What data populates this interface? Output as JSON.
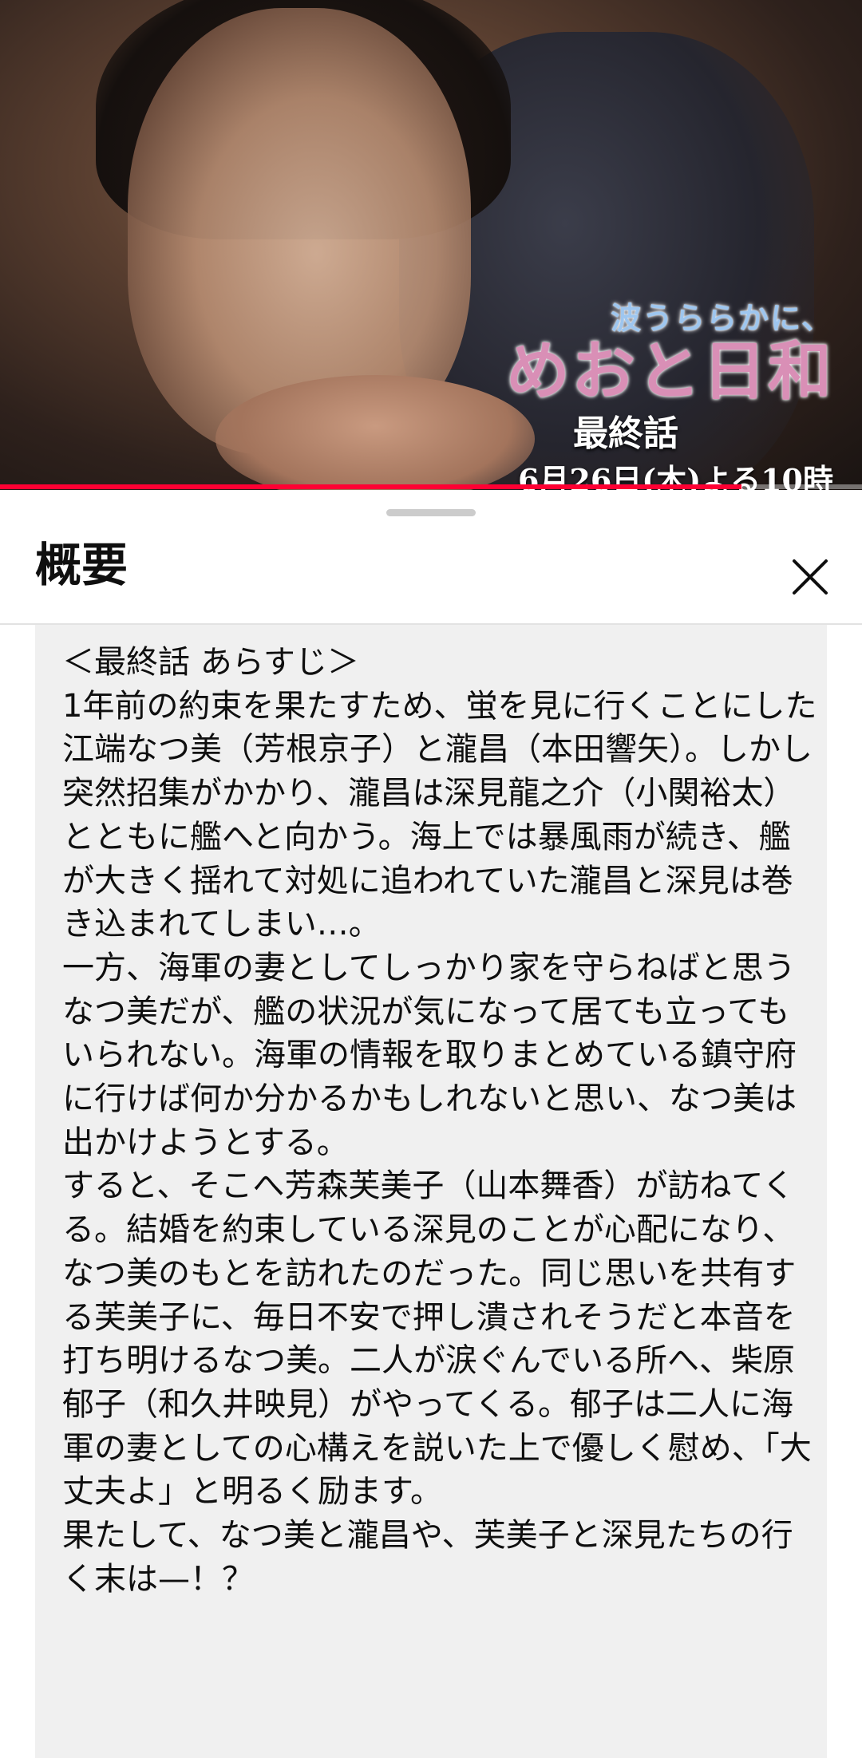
{
  "video": {
    "overlay_subtitle": "波うららかに、",
    "overlay_title": "めおと日和",
    "overlay_episode": "最終話",
    "overlay_airtime": "6月26日(木)よる10時",
    "progress_fraction": 0.86,
    "progress_color": "#ff0033"
  },
  "sheet": {
    "title": "概要",
    "close_icon": "close-icon",
    "description": "＜最終話 あらすじ＞\n1年前の約束を果たすため、蛍を見に行くことにした江端なつ美（芳根京子）と瀧昌（本田響矢）。しかし突然招集がかかり、瀧昌は深見龍之介（小関裕太）とともに艦へと向かう。海上では暴風雨が続き、艦が大きく揺れて対処に追われていた瀧昌と深見は巻き込まれてしまい…。\n一方、海軍の妻としてしっかり家を守らねばと思うなつ美だが、艦の状況が気になって居ても立ってもいられない。海軍の情報を取りまとめている鎮守府に行けば何か分かるかもしれないと思い、なつ美は出かけようとする。\nすると、そこへ芳森芙美子（山本舞香）が訪ねてくる。結婚を約束している深見のことが心配になり、なつ美のもとを訪れたのだった。同じ思いを共有する芙美子に、毎日不安で押し潰されそうだと本音を打ち明けるなつ美。二人が涙ぐんでいる所へ、柴原郁子（和久井映見）がやってくる。郁子は二人に海軍の妻としての心構えを説いた上で優しく慰め、「大丈夫よ」と明るく励ます。\n果たして、なつ美と瀧昌や、芙美子と深見たちの行く末は—！？"
  }
}
